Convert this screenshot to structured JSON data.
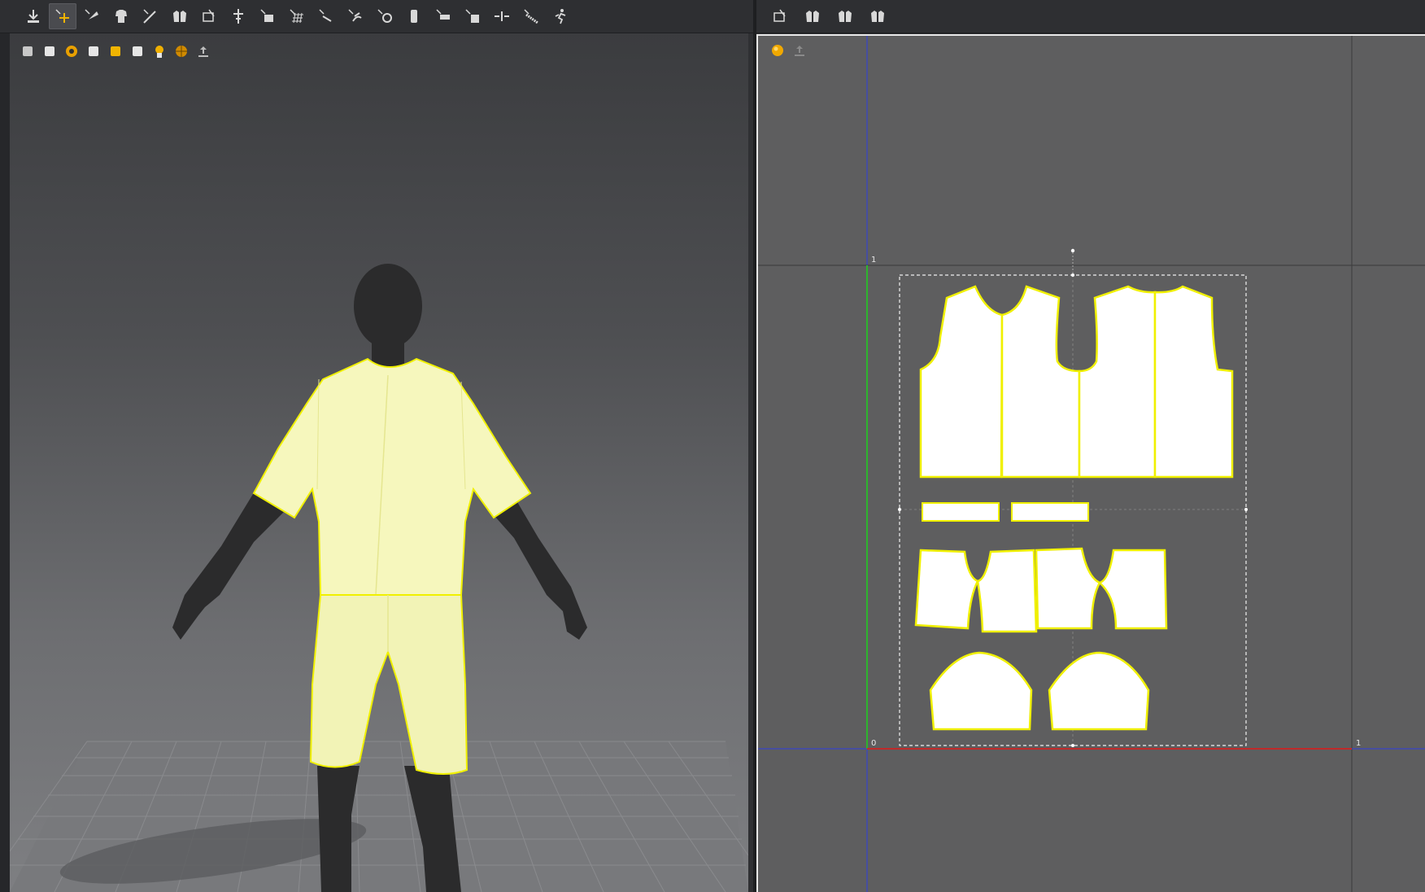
{
  "app": {
    "colors": {
      "garment_fill": "#f6f7bd",
      "seam_outline": "#f0f000",
      "pattern_piece_fill": "#ffffff",
      "pattern_bg": "#5e5e5f",
      "avatar_skin": "#2b2b2c",
      "axis_x": "#c02a2a",
      "axis_y": "#2db52d",
      "guide_blue": "#2f3fe0"
    }
  },
  "left_toolbar": {
    "tools": [
      {
        "name": "select-mesh-icon",
        "active": false
      },
      {
        "name": "select-move-icon",
        "active": true
      },
      {
        "name": "fold-arrangement-icon",
        "active": false
      },
      {
        "name": "garment-fit-icon",
        "active": false
      },
      {
        "name": "tack-icon",
        "active": false
      },
      {
        "name": "symmetry-pattern-icon",
        "active": false
      },
      {
        "name": "arrangement-point-icon",
        "active": false
      },
      {
        "name": "pin-icon",
        "active": false
      },
      {
        "name": "fold-icon",
        "active": false
      },
      {
        "name": "grid-texture-icon",
        "active": false
      },
      {
        "name": "measure-icon",
        "active": false
      },
      {
        "name": "steam-icon",
        "active": false
      },
      {
        "name": "avatar-point-icon",
        "active": false
      },
      {
        "name": "button-icon",
        "active": false
      },
      {
        "name": "flat-icon",
        "active": false
      },
      {
        "name": "strengthen-icon",
        "active": false
      },
      {
        "name": "shrink-icon",
        "active": false
      },
      {
        "name": "tape-measure-icon",
        "active": false
      },
      {
        "name": "walk-icon",
        "active": false
      }
    ],
    "view_tools": [
      "view-avatar-icon",
      "view-garment-icon",
      "view-texture-icon",
      "view-avatar-only-icon",
      "view-folder-icon",
      "view-cloth-icon",
      "view-skin-icon",
      "view-wire-icon",
      "export-icon"
    ]
  },
  "right_toolbar": {
    "tools": [
      "pattern-snapshot-icon",
      "garment-snapshot-icon",
      "arrange-pieces-icon",
      "symmetry-pieces-icon"
    ],
    "view_tools": [
      "color-sphere-icon",
      "upload-icon"
    ]
  },
  "pattern_view": {
    "axis_labels": {
      "origin": "0",
      "top_y": "1",
      "right_x": "1"
    }
  }
}
